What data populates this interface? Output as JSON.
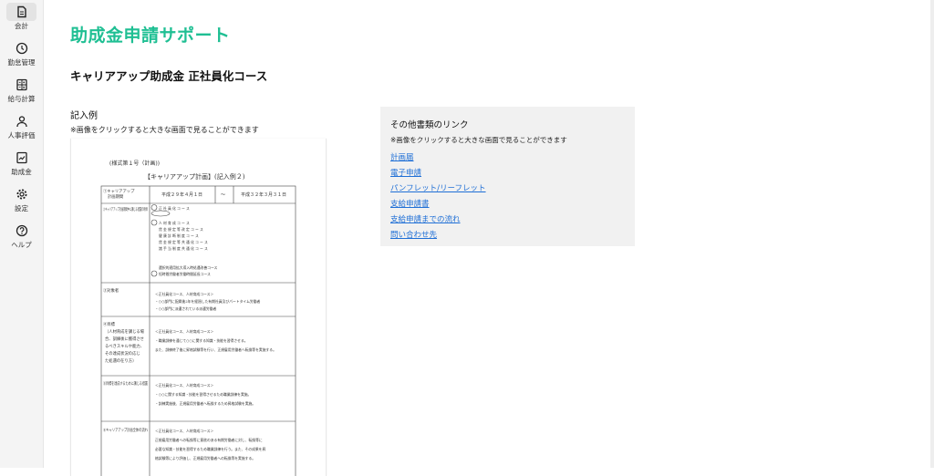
{
  "sidebar": {
    "items": [
      {
        "label": "会計",
        "icon": "document-icon",
        "active": true
      },
      {
        "label": "勤怠管理",
        "icon": "clock-icon",
        "active": false
      },
      {
        "label": "給与計算",
        "icon": "calculator-icon",
        "active": false
      },
      {
        "label": "人事評価",
        "icon": "person-icon",
        "active": false
      },
      {
        "label": "助成金",
        "icon": "grant-icon",
        "active": false
      },
      {
        "label": "設定",
        "icon": "gear-icon",
        "active": false
      },
      {
        "label": "ヘルプ",
        "icon": "help-icon",
        "active": false
      }
    ]
  },
  "header": {
    "title": "助成金申請サポート",
    "accent_color": "#1fbf93"
  },
  "main": {
    "course_title": "キャリアアップ助成金 正社員化コース",
    "example_label": "記入例",
    "click_note": "※画像をクリックすると大きな画面で見ることができます",
    "document": {
      "form_no": "(様式第１号（計画))",
      "heading": "【キャリアアップ計画】(記入例２)",
      "row1_label_a": "①キャリアアップ",
      "row1_label_b": "計画期間",
      "date_from": "平成２９年４月１日",
      "date_sep": "〜",
      "date_to": "平成３２年３月３１日",
      "row2_label": "②キャリアアップ計画期間中に講じる措置の項目",
      "row2_items": [
        "正 社 員 化 コ ー ス",
        "人 材 育 成 コ ー ス",
        "賃 金 規 定 等 改 定 コ ー ス",
        "健 康 診 断 制 度 コ ー ス",
        "賃 金 規 定 等 共 通 化 コ ー ス",
        "諸 手 当 制 度 共 通 化 コ ー ス",
        "選択的適用拡大導入時処遇改善コース",
        "短時間労働者労働時間延長コース"
      ],
      "row3_label": "③対象者",
      "row3_lines": [
        "＜正社員化コース、人材育成コース＞",
        "・○○部門に配属後2年を経過した有期社員及びパートタイム労働者",
        "・○○部門に派遣されている派遣労働者"
      ],
      "row4_label": "④目標",
      "row4_sub": [
        "（人材育成を講じる場",
        "合、訓練後に獲得させ",
        "るべきスキルや能力、",
        "その達成状況の応じ",
        "た処遇の在り方）"
      ],
      "row4_lines": [
        "＜正社員化コース、人材育成コース＞",
        "・職業訓練を通じて○○に関する知識・技能を習得させる。",
        "また、訓練終了後に昇格試験等を行い、正規雇用労働者へ転換等を実施する。"
      ],
      "row5_label": "⑤目標を達成するために講じる措置",
      "row5_lines": [
        "＜正社員化コース、人材育成コース＞",
        "・○○に関する知識・技能を習得させるため職業訓練を実施。",
        "・訓練実施後、正規雇用労働者へ転換するため昇格試験を実施。"
      ],
      "row6_label": "⑥キャリアアップ計画全体の流れ",
      "row6_lines": [
        "＜正社員化コース、人材育成コース＞",
        "正規雇用労働者への転換等に意欲のある有期労働者に対し、転換等に",
        "必要な知識・技能を習得するため職業訓練を行う。また、その成果を昇",
        "格試験等により評価し、正規雇用労働者への転換等を実施する。"
      ]
    }
  },
  "links": {
    "title": "その他書類のリンク",
    "note": "※画像をクリックすると大きな画面で見ることができます",
    "items": [
      "計画届",
      "電子申請",
      "パンフレット/リーフレット",
      "支給申請書",
      "支給申請までの流れ",
      "問い合わせ先"
    ],
    "link_color": "#1f6fd6"
  }
}
